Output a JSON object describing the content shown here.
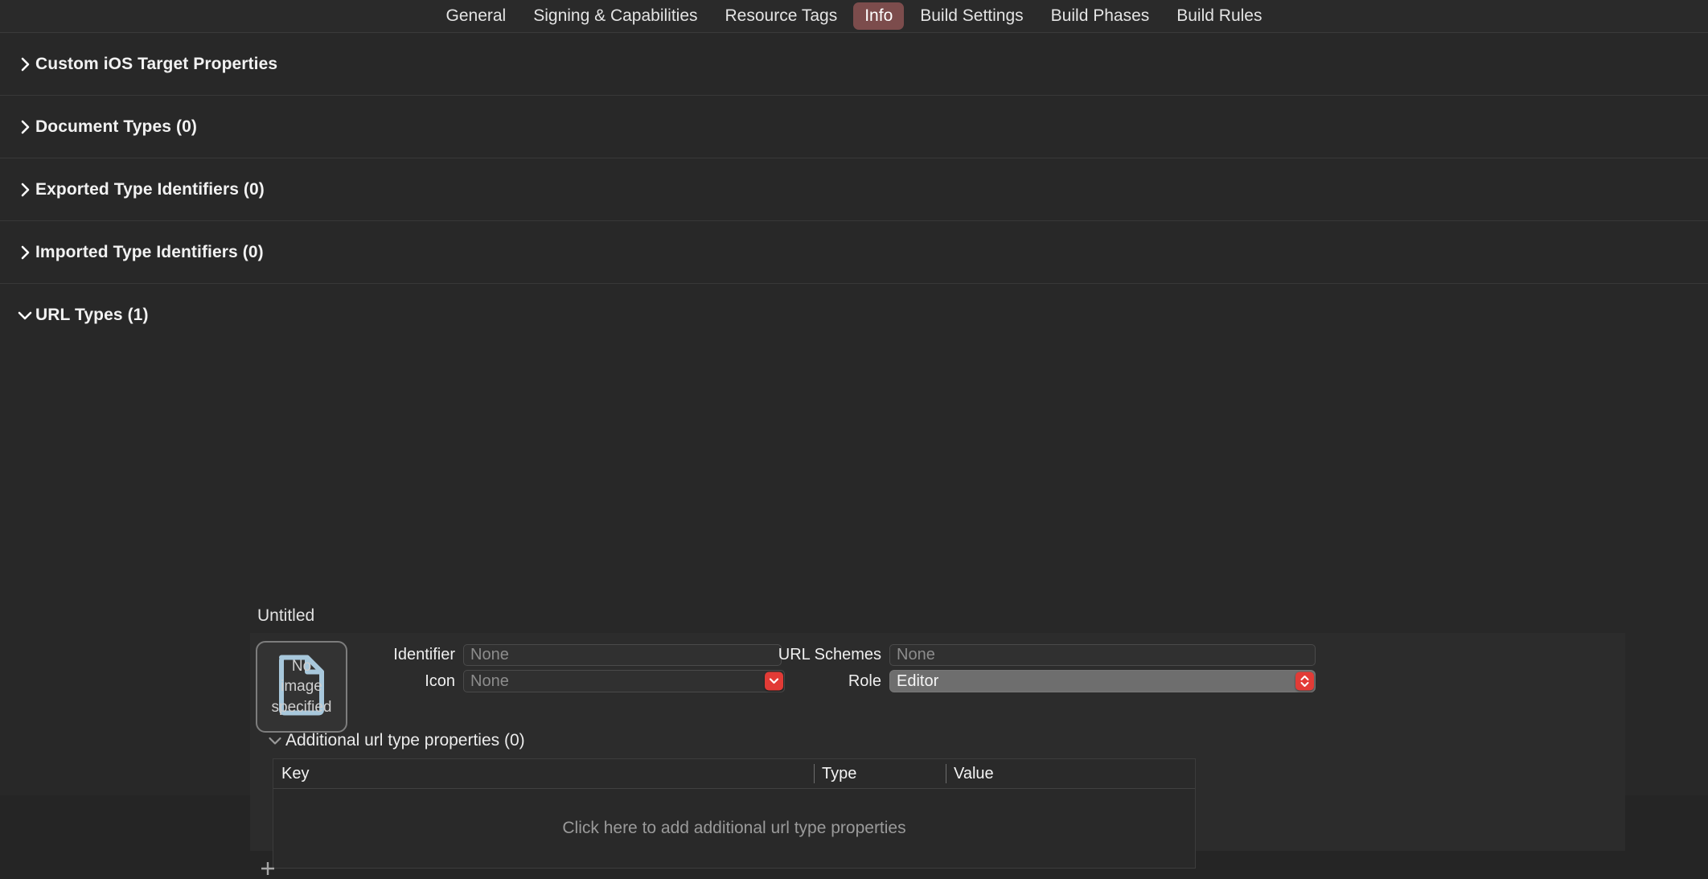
{
  "tabs": [
    {
      "label": "General",
      "active": false
    },
    {
      "label": "Signing & Capabilities",
      "active": false
    },
    {
      "label": "Resource Tags",
      "active": false
    },
    {
      "label": "Info",
      "active": true
    },
    {
      "label": "Build Settings",
      "active": false
    },
    {
      "label": "Build Phases",
      "active": false
    },
    {
      "label": "Build Rules",
      "active": false
    }
  ],
  "sections": [
    {
      "title": "Custom iOS Target Properties",
      "expanded": false
    },
    {
      "title": "Document Types (0)",
      "expanded": false
    },
    {
      "title": "Exported Type Identifiers (0)",
      "expanded": false
    },
    {
      "title": "Imported Type Identifiers (0)",
      "expanded": false
    },
    {
      "title": "URL Types (1)",
      "expanded": true
    }
  ],
  "url_type": {
    "item_title": "Untitled",
    "icon_well": {
      "placeholder_text": "No image specified",
      "glyph": "document-icon",
      "glyph_color": "#a8c8dc"
    },
    "fields": {
      "identifier_label": "Identifier",
      "identifier_value": "",
      "identifier_placeholder": "None",
      "icon_label": "Icon",
      "icon_value": "",
      "icon_placeholder": "None",
      "url_schemes_label": "URL Schemes",
      "url_schemes_value": "",
      "url_schemes_placeholder": "None",
      "role_label": "Role",
      "role_value": "Editor"
    },
    "additional": {
      "label": "Additional url type properties (0)",
      "expanded": true,
      "columns": [
        "Key",
        "Type",
        "Value"
      ],
      "rows": [],
      "empty_message": "Click here to add additional url type properties"
    },
    "add_button_label": "+"
  },
  "colors": {
    "accent_tab": "#7c4c4c",
    "red_control": "#e23b36",
    "background": "#282828",
    "panel": "#2c2c2c"
  }
}
